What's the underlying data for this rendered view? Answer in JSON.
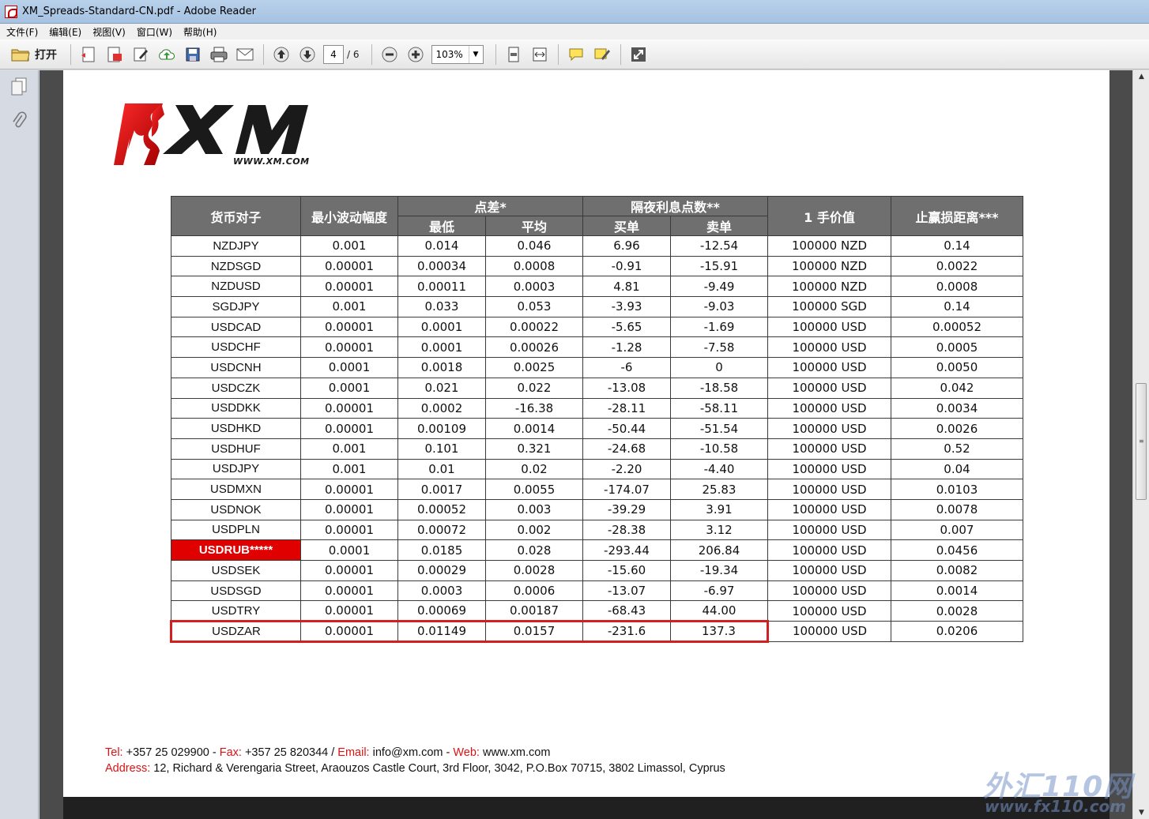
{
  "window": {
    "title": "XM_Spreads-Standard-CN.pdf - Adobe Reader"
  },
  "menu": [
    "文件(F)",
    "编辑(E)",
    "视图(V)",
    "窗口(W)",
    "帮助(H)"
  ],
  "toolbar": {
    "open_label": "打开",
    "page_current": "4",
    "page_total": "/ 6",
    "zoom": "103%"
  },
  "logo": {
    "url": "WWW.XM.COM"
  },
  "table": {
    "headers": {
      "pair": "货币对子",
      "min_tick": "最小波动幅度",
      "spread": "点差*",
      "spread_low": "最低",
      "spread_avg": "平均",
      "swap": "隔夜利息点数**",
      "swap_buy": "买单",
      "swap_sell": "卖单",
      "lot_value": "1 手价值",
      "sl_distance": "止赢损距离***"
    },
    "rows": [
      [
        "NZDJPY",
        "0.001",
        "0.014",
        "0.046",
        "6.96",
        "-12.54",
        "100000 NZD",
        "0.14"
      ],
      [
        "NZDSGD",
        "0.00001",
        "0.00034",
        "0.0008",
        "-0.91",
        "-15.91",
        "100000 NZD",
        "0.0022"
      ],
      [
        "NZDUSD",
        "0.00001",
        "0.00011",
        "0.0003",
        "4.81",
        "-9.49",
        "100000 NZD",
        "0.0008"
      ],
      [
        "SGDJPY",
        "0.001",
        "0.033",
        "0.053",
        "-3.93",
        "-9.03",
        "100000 SGD",
        "0.14"
      ],
      [
        "USDCAD",
        "0.00001",
        "0.0001",
        "0.00022",
        "-5.65",
        "-1.69",
        "100000 USD",
        "0.00052"
      ],
      [
        "USDCHF",
        "0.00001",
        "0.0001",
        "0.00026",
        "-1.28",
        "-7.58",
        "100000 USD",
        "0.0005"
      ],
      [
        "USDCNH",
        "0.0001",
        "0.0018",
        "0.0025",
        "-6",
        "0",
        "100000 USD",
        "0.0050"
      ],
      [
        "USDCZK",
        "0.0001",
        "0.021",
        "0.022",
        "-13.08",
        "-18.58",
        "100000 USD",
        "0.042"
      ],
      [
        "USDDKK",
        "0.00001",
        "0.0002",
        "-16.38",
        "-28.11",
        "-58.11",
        "100000 USD",
        "0.0034"
      ],
      [
        "USDHKD",
        "0.00001",
        "0.00109",
        "0.0014",
        "-50.44",
        "-51.54",
        "100000 USD",
        "0.0026"
      ],
      [
        "USDHUF",
        "0.001",
        "0.101",
        "0.321",
        "-24.68",
        "-10.58",
        "100000 USD",
        "0.52"
      ],
      [
        "USDJPY",
        "0.001",
        "0.01",
        "0.02",
        "-2.20",
        "-4.40",
        "100000 USD",
        "0.04"
      ],
      [
        "USDMXN",
        "0.00001",
        "0.0017",
        "0.0055",
        "-174.07",
        "25.83",
        "100000 USD",
        "0.0103"
      ],
      [
        "USDNOK",
        "0.00001",
        "0.00052",
        "0.003",
        "-39.29",
        "3.91",
        "100000 USD",
        "0.0078"
      ],
      [
        "USDPLN",
        "0.00001",
        "0.00072",
        "0.002",
        "-28.38",
        "3.12",
        "100000 USD",
        "0.007"
      ],
      [
        "USDRUB*****",
        "0.0001",
        "0.0185",
        "0.028",
        "-293.44",
        "206.84",
        "100000 USD",
        "0.0456"
      ],
      [
        "USDSEK",
        "0.00001",
        "0.00029",
        "0.0028",
        "-15.60",
        "-19.34",
        "100000 USD",
        "0.0082"
      ],
      [
        "USDSGD",
        "0.00001",
        "0.0003",
        "0.0006",
        "-13.07",
        "-6.97",
        "100000 USD",
        "0.0014"
      ],
      [
        "USDTRY",
        "0.00001",
        "0.00069",
        "0.00187",
        "-68.43",
        "44.00",
        "100000 USD",
        "0.0028"
      ],
      [
        "USDZAR",
        "0.00001",
        "0.01149",
        "0.0157",
        "-231.6",
        "137.3",
        "100000 USD",
        "0.0206"
      ]
    ],
    "highlight_pair": "USDRUB*****",
    "highlight_color": "#e00000",
    "boxed_pair": "USDZAR"
  },
  "footer": {
    "tel_label": "Tel:",
    "tel": "+357 25 029900",
    "sep1": " - ",
    "fax_label": "Fax:",
    "fax": "+357 25 820344",
    "sep2": "  /  ",
    "email_label": "Email:",
    "email": "info@xm.com",
    "sep3": " - ",
    "web_label": "Web:",
    "web": "www.xm.com",
    "address_label": "Address:",
    "address": "12, Richard & Verengaria Street, Araouzos Castle Court, 3rd Floor, 3042, P.O.Box 70715, 3802 Limassol, Cyprus"
  },
  "watermark": {
    "text": "外汇110网",
    "url": "www.fx110.com"
  }
}
